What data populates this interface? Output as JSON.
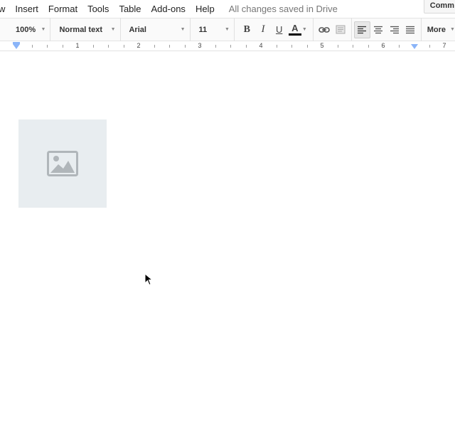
{
  "menubar": {
    "items": [
      "w",
      "Insert",
      "Format",
      "Tools",
      "Table",
      "Add-ons",
      "Help"
    ],
    "save_status": "All changes saved in Drive",
    "comments_label": "Comm"
  },
  "toolbar": {
    "zoom": "100%",
    "style": "Normal text",
    "font": "Arial",
    "size": "11",
    "bold_label": "B",
    "italic_label": "I",
    "underline_label": "U",
    "text_color_label": "A",
    "more_label": "More",
    "icons": [
      "link-icon",
      "comment-icon",
      "align-left-icon",
      "align-center-icon",
      "align-right-icon",
      "align-justify-icon"
    ]
  },
  "ruler": {
    "numbers": [
      "1",
      "2",
      "3",
      "4",
      "5",
      "6",
      "7"
    ]
  },
  "document": {
    "image_icon": "image-placeholder-icon"
  },
  "colors": {
    "toolbar_bg": "#fafafa",
    "image_placeholder_bg": "#e8edf0",
    "ruler_marker": "#8ab4f8",
    "save_status": "#777777"
  }
}
